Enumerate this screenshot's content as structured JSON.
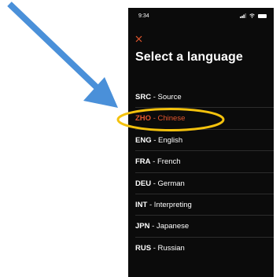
{
  "status_bar": {
    "time": "9:34"
  },
  "header": {
    "close_icon": "close-icon",
    "title": "Select a language"
  },
  "languages": [
    {
      "code": "SRC",
      "name": "Source",
      "selected": false
    },
    {
      "code": "ZHO",
      "name": "Chinese",
      "selected": true
    },
    {
      "code": "ENG",
      "name": "English",
      "selected": false
    },
    {
      "code": "FRA",
      "name": "French",
      "selected": false
    },
    {
      "code": "DEU",
      "name": "German",
      "selected": false
    },
    {
      "code": "INT",
      "name": "Interpreting",
      "selected": false
    },
    {
      "code": "JPN",
      "name": "Japanese",
      "selected": false
    },
    {
      "code": "RUS",
      "name": "Russian",
      "selected": false
    }
  ],
  "separator": " - ",
  "colors": {
    "background": "#0b0b0b",
    "accent": "#e4572e",
    "highlight_ring": "#f4c20d",
    "callout_arrow": "#4a90d9"
  }
}
